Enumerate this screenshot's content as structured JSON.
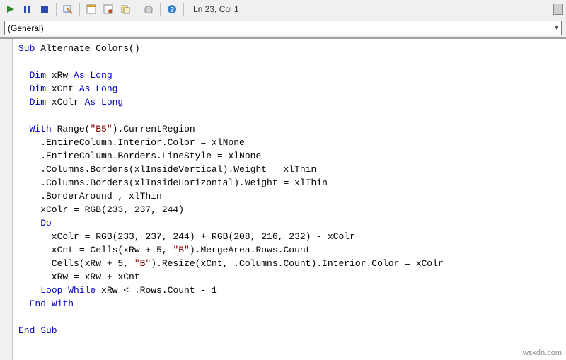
{
  "toolbar": {
    "cursor_position": "Ln 23, Col 1"
  },
  "dropdown": {
    "selected": "(General)"
  },
  "code": {
    "line1": [
      [
        "kw",
        "Sub"
      ],
      [
        "tx",
        " Alternate_Colors()"
      ]
    ],
    "line2": [],
    "line3": [
      [
        "tx",
        "  "
      ],
      [
        "kw",
        "Dim"
      ],
      [
        "tx",
        " xRw "
      ],
      [
        "kw",
        "As Long"
      ]
    ],
    "line4": [
      [
        "tx",
        "  "
      ],
      [
        "kw",
        "Dim"
      ],
      [
        "tx",
        " xCnt "
      ],
      [
        "kw",
        "As Long"
      ]
    ],
    "line5": [
      [
        "tx",
        "  "
      ],
      [
        "kw",
        "Dim"
      ],
      [
        "tx",
        " xColr "
      ],
      [
        "kw",
        "As Long"
      ]
    ],
    "line6": [],
    "line7": [
      [
        "tx",
        "  "
      ],
      [
        "kw",
        "With"
      ],
      [
        "tx",
        " Range("
      ],
      [
        "str",
        "\"B5\""
      ],
      [
        "tx",
        ").CurrentRegion"
      ]
    ],
    "line8": [
      [
        "tx",
        "    .EntireColumn.Interior.Color = xlNone"
      ]
    ],
    "line9": [
      [
        "tx",
        "    .EntireColumn.Borders.LineStyle = xlNone"
      ]
    ],
    "line10": [
      [
        "tx",
        "    .Columns.Borders(xlInsideVertical).Weight = xlThin"
      ]
    ],
    "line11": [
      [
        "tx",
        "    .Columns.Borders(xlInsideHorizontal).Weight = xlThin"
      ]
    ],
    "line12": [
      [
        "tx",
        "    .BorderAround , xlThin"
      ]
    ],
    "line13": [
      [
        "tx",
        "    xColr = RGB(233, 237, 244)"
      ]
    ],
    "line14": [
      [
        "tx",
        "    "
      ],
      [
        "kw",
        "Do"
      ]
    ],
    "line15": [
      [
        "tx",
        "      xColr = RGB(233, 237, 244) + RGB(208, 216, 232) - xColr"
      ]
    ],
    "line16": [
      [
        "tx",
        "      xCnt = Cells(xRw + 5, "
      ],
      [
        "str",
        "\"B\""
      ],
      [
        "tx",
        ").MergeArea.Rows.Count"
      ]
    ],
    "line17": [
      [
        "tx",
        "      Cells(xRw + 5, "
      ],
      [
        "str",
        "\"B\""
      ],
      [
        "tx",
        ").Resize(xCnt, .Columns.Count).Interior.Color = xColr"
      ]
    ],
    "line18": [
      [
        "tx",
        "      xRw = xRw + xCnt"
      ]
    ],
    "line19": [
      [
        "tx",
        "    "
      ],
      [
        "kw",
        "Loop While"
      ],
      [
        "tx",
        " xRw < .Rows.Count - 1"
      ]
    ],
    "line20": [
      [
        "tx",
        "  "
      ],
      [
        "kw",
        "End With"
      ]
    ],
    "line21": [],
    "line22": [
      [
        "kw",
        "End Sub"
      ]
    ]
  },
  "watermark": "wsxdn.com"
}
